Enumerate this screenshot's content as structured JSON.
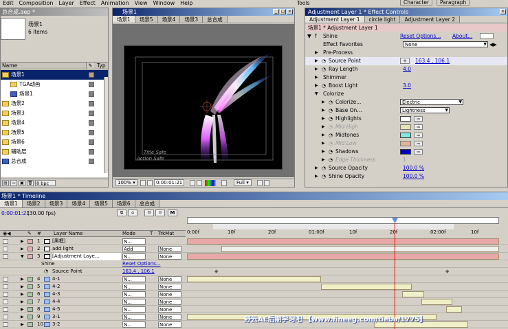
{
  "menu": [
    "Edit",
    "Composition",
    "Layer",
    "Effect",
    "Animation",
    "View",
    "Window",
    "Help"
  ],
  "tools_title": "Tools",
  "character_tab": "Character",
  "paragraph_tab": "Paragraph",
  "project": {
    "title": "总合成.aep *",
    "comp_name": "场景1",
    "items_count": "6 items",
    "col_name": "Name",
    "col_type": "Typ",
    "bpc": "8 bpc",
    "items": [
      {
        "label": "场景1",
        "kind": "folder",
        "depth": 0,
        "selected": true,
        "color": "#c0a080"
      },
      {
        "label": "TGA动画",
        "kind": "folder",
        "depth": 1,
        "color": "#808080"
      },
      {
        "label": "场景1",
        "kind": "comp",
        "depth": 1,
        "color": "#808080"
      },
      {
        "label": "场景2",
        "kind": "folder",
        "depth": 0,
        "color": "#808080"
      },
      {
        "label": "场景3",
        "kind": "folder",
        "depth": 0,
        "color": "#808080"
      },
      {
        "label": "场景4",
        "kind": "folder",
        "depth": 0,
        "color": "#808080"
      },
      {
        "label": "场景5",
        "kind": "folder",
        "depth": 0,
        "color": "#808080"
      },
      {
        "label": "场景6",
        "kind": "folder",
        "depth": 0,
        "color": "#808080"
      },
      {
        "label": "辅助层",
        "kind": "folder",
        "depth": 0,
        "color": "#808080"
      },
      {
        "label": "总合成",
        "kind": "comp",
        "depth": 0,
        "color": "#808080"
      }
    ]
  },
  "comp": {
    "title": "场景1",
    "tabs": [
      "场景1",
      "场景5",
      "场景4",
      "场景3",
      "总合成"
    ],
    "zoom": "100%",
    "time": "0:00:01:21",
    "quality": "Full",
    "title_safe": "Title Safe",
    "action_safe": "Action Safe"
  },
  "effects": {
    "title": "Adjustment Layer 1 * Effect Controls",
    "tabs": [
      "Adjustment Layer 1",
      "circle light",
      "Adjustment Layer 2"
    ],
    "breadcrumb": "场景1 * Adjustment Layer 1",
    "shine": "Shine",
    "reset": "Reset Options...",
    "about": "About...",
    "rows": [
      {
        "label": "Effect Favorites",
        "value": "None",
        "type": "dropdown",
        "indent": 1
      },
      {
        "label": "Pre-Process",
        "type": "group",
        "indent": 1
      },
      {
        "label": "Source Point",
        "value": "163.4 , 106.1",
        "type": "point",
        "indent": 1
      },
      {
        "label": "Ray Length",
        "value": "4.0",
        "type": "num",
        "indent": 1
      },
      {
        "label": "Shimmer",
        "type": "group",
        "indent": 1
      },
      {
        "label": "Boost Light",
        "value": "3.0",
        "type": "num",
        "indent": 1
      },
      {
        "label": "Colorize",
        "type": "groupopen",
        "indent": 1
      },
      {
        "label": "Colorize...",
        "value": "Electric",
        "type": "dropdown2",
        "indent": 2
      },
      {
        "label": "Base On...",
        "value": "Lightness",
        "type": "dropdown2",
        "indent": 2
      },
      {
        "label": "Highlights",
        "type": "color",
        "color": "#ffffff",
        "indent": 2
      },
      {
        "label": "Mid High",
        "type": "color",
        "color": "#f0f0a0",
        "indent": 2,
        "dim": true
      },
      {
        "label": "Midtones",
        "type": "color",
        "color": "#80e8e0",
        "indent": 2
      },
      {
        "label": "Mid Low",
        "type": "color",
        "color": "#f0a080",
        "indent": 2,
        "dim": true
      },
      {
        "label": "Shadows",
        "type": "color",
        "color": "#0000c0",
        "indent": 2
      },
      {
        "label": "Edge Thickness",
        "value": "1",
        "type": "dimnum",
        "indent": 2
      },
      {
        "label": "Source Opacity",
        "value": "100.0 %",
        "type": "num",
        "indent": 1
      },
      {
        "label": "Shine Opacity",
        "value": "100.0 %",
        "type": "num",
        "indent": 1
      }
    ]
  },
  "timeline": {
    "title": "场景1 * Timeline",
    "tabs": [
      "场景1",
      "场景2",
      "场景3",
      "场景4",
      "场景5",
      "场景6",
      "总合成"
    ],
    "time": "0:00:01:21",
    "fps": "(30.00 fps)",
    "headers": {
      "num": "#",
      "name": "Layer Name",
      "mode": "Mode",
      "t": "T",
      "trkmat": "TrkMat"
    },
    "ruler": [
      "0:00f",
      "10f",
      "20f",
      "01:00f",
      "10f",
      "20f",
      "02:00f",
      "10f"
    ],
    "layers": [
      {
        "num": "1",
        "name": "[黑框]",
        "mode": "N...",
        "trk": "",
        "color": "#e8b0b0",
        "bar": "#e8a8a8",
        "start": 0.0,
        "end": 1.0
      },
      {
        "num": "2",
        "name": "add light",
        "mode": "Add",
        "trk": "None",
        "color": "#e8b0b0",
        "bar": "#f0f0f0",
        "start": 0.11,
        "end": 1.0
      },
      {
        "num": "3",
        "name": "[Adjustment Laye...",
        "mode": "N...",
        "trk": "None",
        "color": "#e8b0b0",
        "bar": "#e8a8a8",
        "start": 0.0,
        "end": 1.0,
        "open": true
      }
    ],
    "shine_label": "Shine",
    "reset": "Reset Options...",
    "source_point_label": "Source Point",
    "source_point_value": "163.4 , 106.1",
    "sublayers": [
      {
        "num": "4",
        "name": "4-1",
        "mode": "N...",
        "trk": "None",
        "color": "#a8c8a8",
        "start": 0.0,
        "end": 0.43
      },
      {
        "num": "5",
        "name": "4-2",
        "mode": "N...",
        "trk": "None",
        "color": "#a8c8a8",
        "start": 0.43,
        "end": 0.72
      },
      {
        "num": "6",
        "name": "4-3",
        "mode": "N...",
        "trk": "None",
        "color": "#a8c8a8",
        "start": 0.69,
        "end": 0.76
      },
      {
        "num": "7",
        "name": "4-4",
        "mode": "N...",
        "trk": "None",
        "color": "#a8c8a8",
        "start": 0.75,
        "end": 0.85
      },
      {
        "num": "8",
        "name": "4-5",
        "mode": "N...",
        "trk": "None",
        "color": "#a8c8a8",
        "start": 0.83,
        "end": 0.88
      },
      {
        "num": "9",
        "name": "3-1",
        "mode": "N...",
        "trk": "None",
        "color": "#a8c8a8",
        "start": 0.0,
        "end": 0.8
      },
      {
        "num": "10",
        "name": "3-2",
        "mode": "N...",
        "trk": "None",
        "color": "#a8c8a8",
        "start": 0.6,
        "end": 0.9
      }
    ],
    "watermark": "野云AE后期学习吧 【www.fineeg.com/tieba/1775】"
  }
}
